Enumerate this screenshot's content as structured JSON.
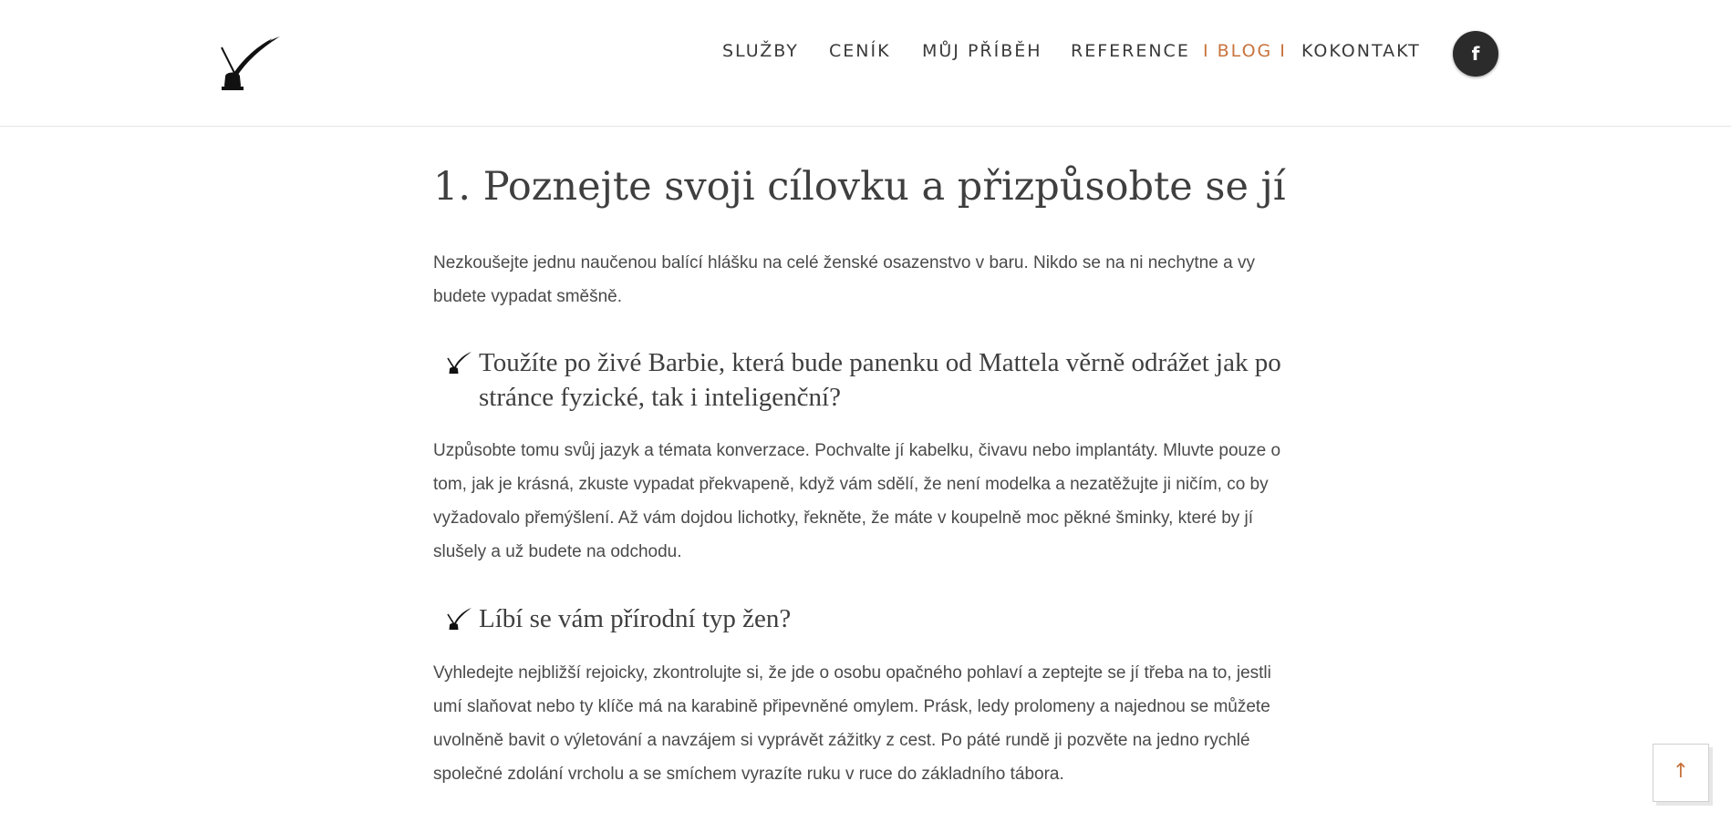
{
  "header": {
    "nav": [
      {
        "label": "SLUŽBY",
        "active": false
      },
      {
        "label": "CENÍK",
        "active": false
      },
      {
        "label": "MŮJ PŘÍBĚH",
        "active": false
      },
      {
        "label": "REFERENCE",
        "active": false
      },
      {
        "label": "I BLOG I",
        "active": true
      },
      {
        "label": "KOKONTAKT",
        "active": false
      }
    ],
    "facebook_label": "f",
    "accent_color": "#c8733d"
  },
  "article": {
    "title": "1. Poznejte svoji cílovku a přizpůsobte se jí",
    "intro": "Nezkoušejte jednu naučenou balící hlášku na celé ženské osazenstvo v baru. Nikdo se na ni nechytne a vy budete vypadat směšně.",
    "sections": [
      {
        "heading": "Toužíte po živé Barbie, která bude panenku od Mattela věrně odrážet jak po stránce fyzické, tak i inteligenční?",
        "body": "Uzpůsobte tomu svůj jazyk a témata konverzace. Pochvalte jí kabelku, čivavu nebo implantáty. Mluvte pouze o tom, jak je krásná, zkuste vypadat překvapeně, když vám sdělí, že není modelka a nezatěžujte ji ničím, co by vyžadovalo přemýšlení. Až vám dojdou lichotky, řekněte, že máte v koupelně moc pěkné šminky, které by jí slušely a už budete na odchodu."
      },
      {
        "heading": "Líbí se vám přírodní typ žen?",
        "body": "Vyhledejte nejbližší rejoicky, zkontrolujte si, že jde o osobu opačného pohlaví a zeptejte se jí třeba na to, jestli umí slaňovat nebo ty klíče má na karabině připevněné omylem. Prásk, ledy prolomeny a najednou se můžete uvolněně bavit o výletování a navzájem si vyprávět zážitky z cest. Po páté rundě ji pozvěte na jedno rychlé společné zdolání vrcholu a se smíchem vyrazíte ruku v ruce do základního tábora."
      }
    ]
  },
  "back_to_top_icon": "arrow-up-icon"
}
